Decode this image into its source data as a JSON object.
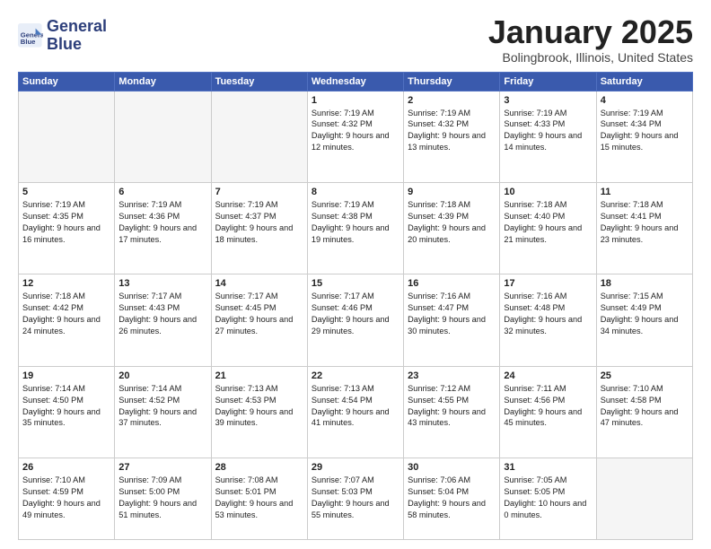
{
  "header": {
    "logo_line1": "General",
    "logo_line2": "Blue",
    "title": "January 2025",
    "location": "Bolingbrook, Illinois, United States"
  },
  "days_of_week": [
    "Sunday",
    "Monday",
    "Tuesday",
    "Wednesday",
    "Thursday",
    "Friday",
    "Saturday"
  ],
  "weeks": [
    [
      {
        "day": "",
        "empty": true
      },
      {
        "day": "",
        "empty": true
      },
      {
        "day": "",
        "empty": true
      },
      {
        "day": "1",
        "sunrise": "7:19 AM",
        "sunset": "4:32 PM",
        "daylight": "9 hours and 12 minutes."
      },
      {
        "day": "2",
        "sunrise": "7:19 AM",
        "sunset": "4:32 PM",
        "daylight": "9 hours and 13 minutes."
      },
      {
        "day": "3",
        "sunrise": "7:19 AM",
        "sunset": "4:33 PM",
        "daylight": "9 hours and 14 minutes."
      },
      {
        "day": "4",
        "sunrise": "7:19 AM",
        "sunset": "4:34 PM",
        "daylight": "9 hours and 15 minutes."
      }
    ],
    [
      {
        "day": "5",
        "sunrise": "7:19 AM",
        "sunset": "4:35 PM",
        "daylight": "9 hours and 16 minutes."
      },
      {
        "day": "6",
        "sunrise": "7:19 AM",
        "sunset": "4:36 PM",
        "daylight": "9 hours and 17 minutes."
      },
      {
        "day": "7",
        "sunrise": "7:19 AM",
        "sunset": "4:37 PM",
        "daylight": "9 hours and 18 minutes."
      },
      {
        "day": "8",
        "sunrise": "7:19 AM",
        "sunset": "4:38 PM",
        "daylight": "9 hours and 19 minutes."
      },
      {
        "day": "9",
        "sunrise": "7:18 AM",
        "sunset": "4:39 PM",
        "daylight": "9 hours and 20 minutes."
      },
      {
        "day": "10",
        "sunrise": "7:18 AM",
        "sunset": "4:40 PM",
        "daylight": "9 hours and 21 minutes."
      },
      {
        "day": "11",
        "sunrise": "7:18 AM",
        "sunset": "4:41 PM",
        "daylight": "9 hours and 23 minutes."
      }
    ],
    [
      {
        "day": "12",
        "sunrise": "7:18 AM",
        "sunset": "4:42 PM",
        "daylight": "9 hours and 24 minutes."
      },
      {
        "day": "13",
        "sunrise": "7:17 AM",
        "sunset": "4:43 PM",
        "daylight": "9 hours and 26 minutes."
      },
      {
        "day": "14",
        "sunrise": "7:17 AM",
        "sunset": "4:45 PM",
        "daylight": "9 hours and 27 minutes."
      },
      {
        "day": "15",
        "sunrise": "7:17 AM",
        "sunset": "4:46 PM",
        "daylight": "9 hours and 29 minutes."
      },
      {
        "day": "16",
        "sunrise": "7:16 AM",
        "sunset": "4:47 PM",
        "daylight": "9 hours and 30 minutes."
      },
      {
        "day": "17",
        "sunrise": "7:16 AM",
        "sunset": "4:48 PM",
        "daylight": "9 hours and 32 minutes."
      },
      {
        "day": "18",
        "sunrise": "7:15 AM",
        "sunset": "4:49 PM",
        "daylight": "9 hours and 34 minutes."
      }
    ],
    [
      {
        "day": "19",
        "sunrise": "7:14 AM",
        "sunset": "4:50 PM",
        "daylight": "9 hours and 35 minutes."
      },
      {
        "day": "20",
        "sunrise": "7:14 AM",
        "sunset": "4:52 PM",
        "daylight": "9 hours and 37 minutes."
      },
      {
        "day": "21",
        "sunrise": "7:13 AM",
        "sunset": "4:53 PM",
        "daylight": "9 hours and 39 minutes."
      },
      {
        "day": "22",
        "sunrise": "7:13 AM",
        "sunset": "4:54 PM",
        "daylight": "9 hours and 41 minutes."
      },
      {
        "day": "23",
        "sunrise": "7:12 AM",
        "sunset": "4:55 PM",
        "daylight": "9 hours and 43 minutes."
      },
      {
        "day": "24",
        "sunrise": "7:11 AM",
        "sunset": "4:56 PM",
        "daylight": "9 hours and 45 minutes."
      },
      {
        "day": "25",
        "sunrise": "7:10 AM",
        "sunset": "4:58 PM",
        "daylight": "9 hours and 47 minutes."
      }
    ],
    [
      {
        "day": "26",
        "sunrise": "7:10 AM",
        "sunset": "4:59 PM",
        "daylight": "9 hours and 49 minutes."
      },
      {
        "day": "27",
        "sunrise": "7:09 AM",
        "sunset": "5:00 PM",
        "daylight": "9 hours and 51 minutes."
      },
      {
        "day": "28",
        "sunrise": "7:08 AM",
        "sunset": "5:01 PM",
        "daylight": "9 hours and 53 minutes."
      },
      {
        "day": "29",
        "sunrise": "7:07 AM",
        "sunset": "5:03 PM",
        "daylight": "9 hours and 55 minutes."
      },
      {
        "day": "30",
        "sunrise": "7:06 AM",
        "sunset": "5:04 PM",
        "daylight": "9 hours and 58 minutes."
      },
      {
        "day": "31",
        "sunrise": "7:05 AM",
        "sunset": "5:05 PM",
        "daylight": "10 hours and 0 minutes."
      },
      {
        "day": "",
        "empty": true
      }
    ]
  ]
}
